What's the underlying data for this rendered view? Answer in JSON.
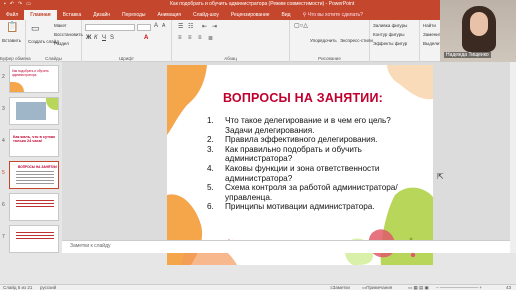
{
  "window": {
    "title": "Как подобрать и обучить администратора (Режим совместимости) - PowerPoint"
  },
  "tabs": [
    "Файл",
    "Главная",
    "Вставка",
    "Дизайн",
    "Переходы",
    "Анимация",
    "Слайд-шоу",
    "Рецензирование",
    "Вид"
  ],
  "tell_me": "Что вы хотите сделать?",
  "ribbon": {
    "paste": "Вставить",
    "create_slide": "Создать слайд",
    "layout": "Макет",
    "reset": "Восстановить",
    "section": "Раздел",
    "groups": {
      "clipboard": "Буфер обмена",
      "slides": "Слайды",
      "font": "Шрифт",
      "paragraph": "Абзац",
      "drawing": "Рисование",
      "editing": "Редактирование"
    },
    "arrange": "Упорядочить",
    "quick_styles": "Экспресс-стили",
    "shape_fill": "Заливка фигуры",
    "shape_outline": "Контур фигуры",
    "shape_effects": "Эффекты фигур",
    "find": "Найти",
    "replace": "Заменить",
    "select": "Выделить"
  },
  "webcam": {
    "name": "Надежда Тищенко"
  },
  "thumbnails": [
    {
      "num": "2",
      "text": "Как подобрать и обучить администратора"
    },
    {
      "num": "3",
      "text": ""
    },
    {
      "num": "4",
      "text": "Как жаль, что в сутках только 24 часа!"
    },
    {
      "num": "5",
      "text": "ВОПРОСЫ НА ЗАНЯТИИ"
    },
    {
      "num": "6",
      "text": ""
    },
    {
      "num": "7",
      "text": ""
    }
  ],
  "slide": {
    "title": "ВОПРОСЫ НА ЗАНЯТИИ:",
    "items": [
      {
        "n": "1.",
        "text": "Что такое делегирование и в чем его цель? Задачи делегирования."
      },
      {
        "n": "2.",
        "text": "Правила эффективного делегирования."
      },
      {
        "n": "3.",
        "text": "Как правильно подобрать и обучить администратора?"
      },
      {
        "n": "4.",
        "text": "Каковы функции и зона ответственности администратора?"
      },
      {
        "n": "5.",
        "text": "Схема контроля за работой администратора/управленца."
      },
      {
        "n": "6.",
        "text": "Принципы мотивации администратора."
      }
    ]
  },
  "notes_placeholder": "Заметки к слайду",
  "status": {
    "slide": "Слайд 5 из 21",
    "lang": "русский",
    "notes": "Заметки",
    "comments": "Примечания",
    "zoom": "43"
  },
  "colors": {
    "accent": "#c4472d",
    "title_red": "#c0002f",
    "blob_orange": "#f5a54a",
    "blob_green": "#b7d65a"
  }
}
